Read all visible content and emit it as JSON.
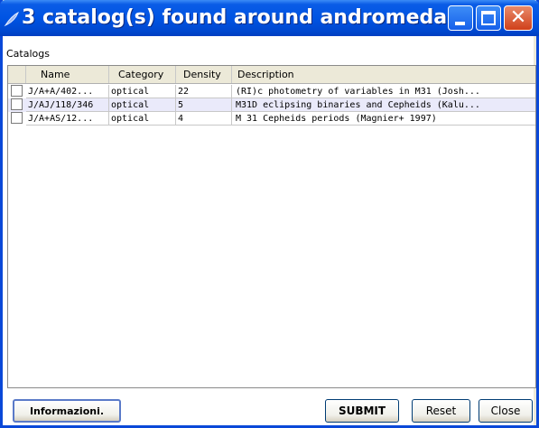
{
  "window": {
    "title": "3 catalog(s) found around andromeda"
  },
  "group_label": "Catalogs",
  "table": {
    "columns": [
      "Name",
      "Category",
      "Density",
      "Description"
    ],
    "rows": [
      {
        "name": "J/A+A/402...",
        "category": "optical",
        "density": "22",
        "description": "(RI)c photometry of variables in M31 (Josh..."
      },
      {
        "name": "J/AJ/118/346",
        "category": "optical",
        "density": "5",
        "description": "M31D eclipsing binaries and Cepheids (Kalu..."
      },
      {
        "name": "J/A+AS/12...",
        "category": "optical",
        "density": "4",
        "description": "M 31 Cepheids periods (Magnier+ 1997)"
      }
    ]
  },
  "buttons": {
    "info": "Informazioni.",
    "submit": "SUBMIT",
    "reset": "Reset",
    "close": "Close"
  },
  "colors": {
    "titlebar": "#0054e3",
    "close_button": "#d0401a"
  }
}
